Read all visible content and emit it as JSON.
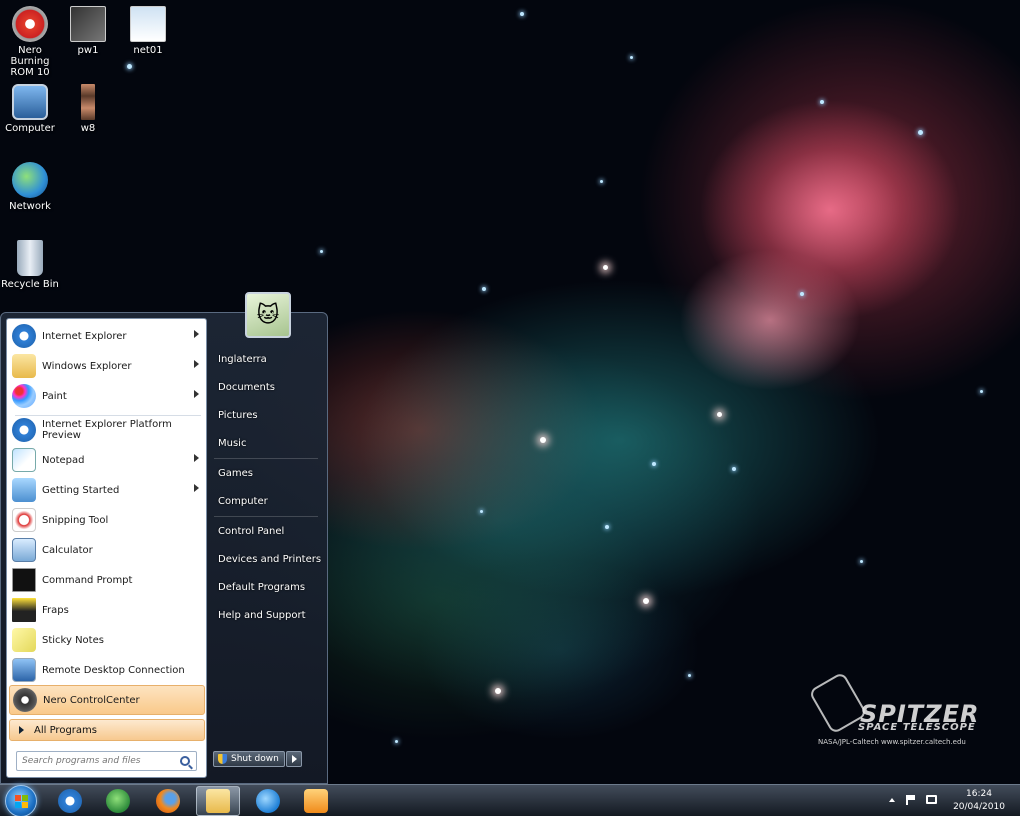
{
  "desktop": {
    "icons": [
      {
        "label": "Nero Burning ROM 10",
        "icon": "nero-disc-icon"
      },
      {
        "label": "pw1",
        "icon": "image-file-icon"
      },
      {
        "label": "net01",
        "icon": "screenshot-file-icon"
      },
      {
        "label": "Computer",
        "icon": "computer-icon"
      },
      {
        "label": "w8",
        "icon": "image-stack-icon"
      },
      {
        "label": "Network",
        "icon": "network-globe-icon"
      },
      {
        "label": "Recycle Bin",
        "icon": "recycle-bin-icon"
      }
    ],
    "wallpaper_logo": {
      "title": "SPITZER",
      "subtitle": "SPACE TELESCOPE",
      "credit": "NASA/JPL-Caltech    www.spitzer.caltech.edu"
    }
  },
  "start_menu": {
    "programs": [
      {
        "label": "Internet Explorer",
        "icon": "internet-explorer-icon",
        "submenu": true
      },
      {
        "label": "Windows Explorer",
        "icon": "folder-icon",
        "submenu": true
      },
      {
        "label": "Paint",
        "icon": "paint-palette-icon",
        "submenu": true
      },
      {
        "label": "Internet Explorer Platform Preview",
        "icon": "internet-explorer-icon",
        "submenu": false
      },
      {
        "label": "Notepad",
        "icon": "notepad-icon",
        "submenu": true
      },
      {
        "label": "Getting Started",
        "icon": "getting-started-icon",
        "submenu": true
      },
      {
        "label": "Snipping Tool",
        "icon": "scissors-icon",
        "submenu": false
      },
      {
        "label": "Calculator",
        "icon": "calculator-icon",
        "submenu": false
      },
      {
        "label": "Command Prompt",
        "icon": "command-prompt-icon",
        "submenu": false
      },
      {
        "label": "Fraps",
        "icon": "fraps-icon",
        "submenu": false
      },
      {
        "label": "Sticky Notes",
        "icon": "sticky-notes-icon",
        "submenu": false
      },
      {
        "label": "Remote Desktop Connection",
        "icon": "remote-desktop-icon",
        "submenu": false
      },
      {
        "label": "Nero ControlCenter",
        "icon": "nero-icon",
        "submenu": false
      }
    ],
    "all_programs_label": "All Programs",
    "search_placeholder": "Search programs and files",
    "right_items": [
      "Inglaterra",
      "Documents",
      "Pictures",
      "Music",
      "Games",
      "Computer",
      "Control Panel",
      "Devices and Printers",
      "Default Programs",
      "Help and Support"
    ],
    "shutdown_label": "Shut down"
  },
  "taskbar": {
    "pinned": [
      {
        "name": "internet-explorer",
        "icon": "internet-explorer-icon",
        "active": false
      },
      {
        "name": "windows-media-center",
        "icon": "windows-flag-icon",
        "active": false
      },
      {
        "name": "firefox",
        "icon": "firefox-icon",
        "active": false
      },
      {
        "name": "windows-explorer",
        "icon": "folder-icon",
        "active": true
      },
      {
        "name": "skype",
        "icon": "skype-icon",
        "active": false
      },
      {
        "name": "media-player",
        "icon": "media-player-icon",
        "active": false
      }
    ],
    "clock_time": "16:24",
    "clock_date": "20/04/2010"
  }
}
